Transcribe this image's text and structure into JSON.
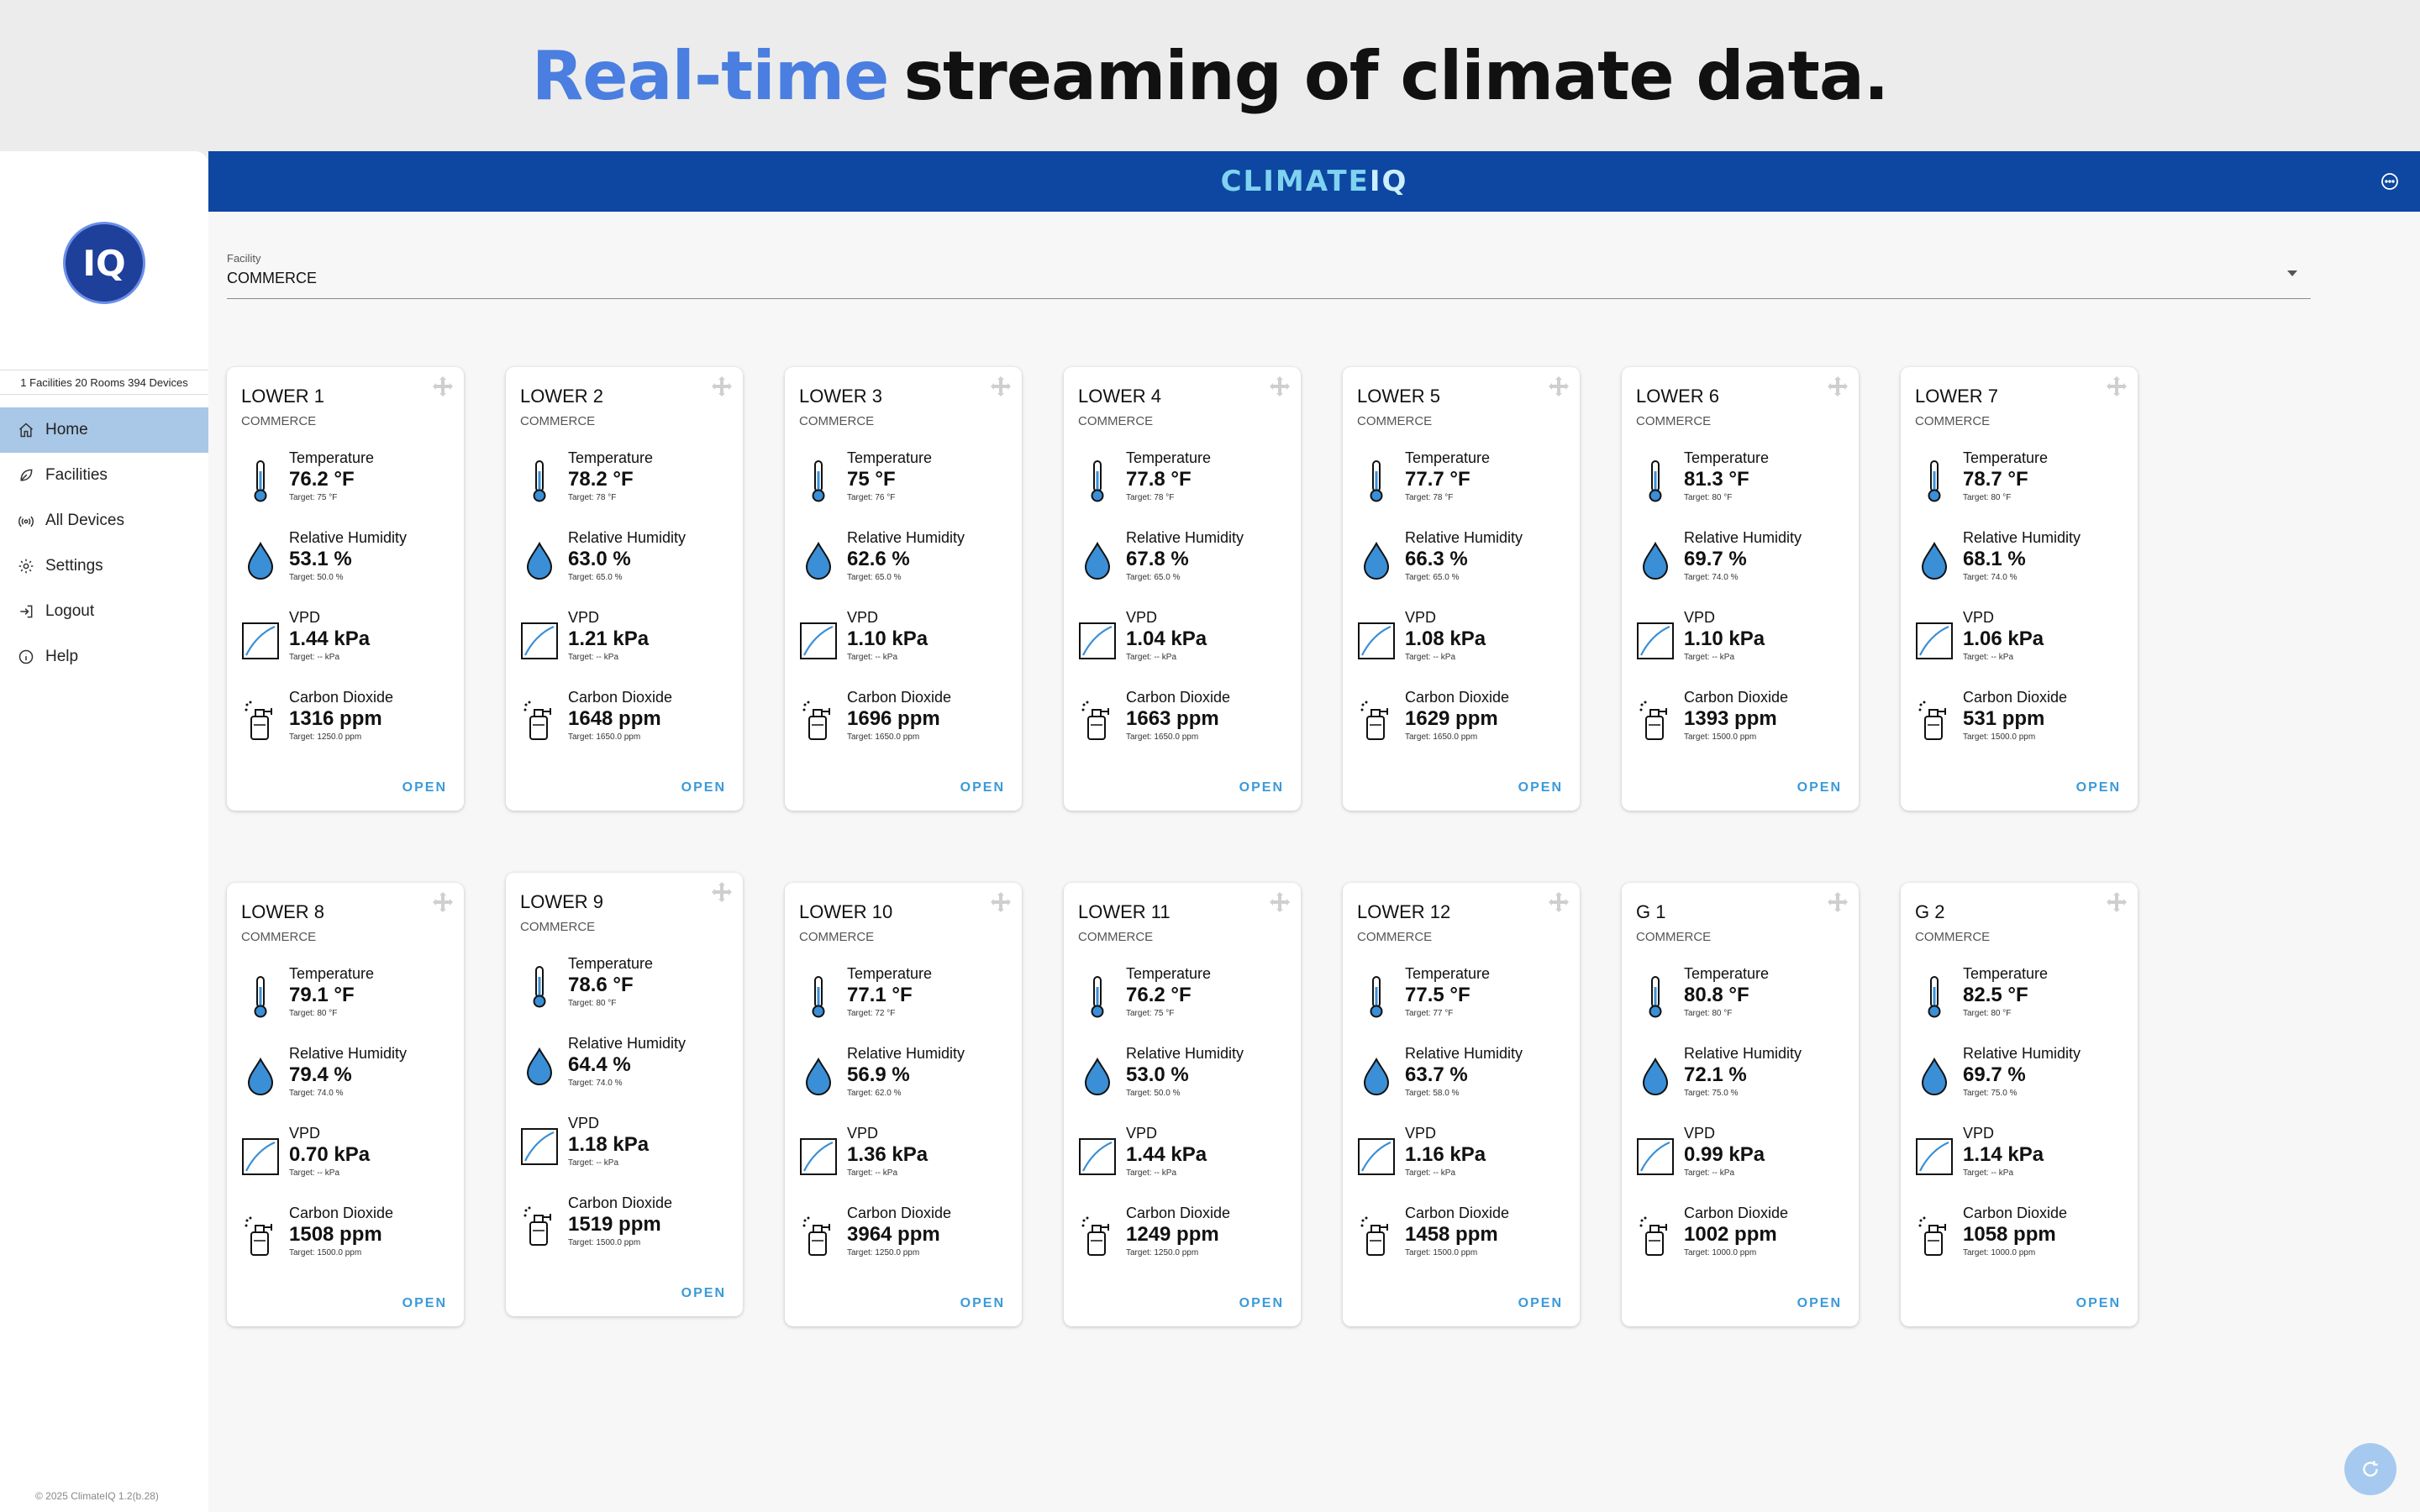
{
  "hero": {
    "accent": "Real-time",
    "rest": "streaming of climate data."
  },
  "brand": {
    "name_main": "CLIMATE",
    "name_iq": "IQ"
  },
  "sidebar": {
    "logo_text": "IQ",
    "stats": "1 Facilities 20 Rooms 394 Devices",
    "nav": [
      {
        "label": "Home",
        "icon": "home-icon",
        "active": true
      },
      {
        "label": "Facilities",
        "icon": "leaf-icon",
        "active": false
      },
      {
        "label": "All Devices",
        "icon": "sensor-icon",
        "active": false
      },
      {
        "label": "Settings",
        "icon": "gear-icon",
        "active": false
      },
      {
        "label": "Logout",
        "icon": "logout-icon",
        "active": false
      },
      {
        "label": "Help",
        "icon": "info-icon",
        "active": false
      }
    ],
    "copyright": "© 2025 ClimateIQ 1.2(b.28)"
  },
  "facility": {
    "label": "Facility",
    "value": "COMMERCE"
  },
  "labels": {
    "temperature": "Temperature",
    "humidity": "Relative Humidity",
    "vpd": "VPD",
    "co2": "Carbon Dioxide",
    "open": "OPEN"
  },
  "colors": {
    "appbar": "#0d47a1",
    "accent": "#4a7ee0",
    "drop": "#3a8fd6",
    "active_nav": "#a9c7e6",
    "open": "#3a9ad9"
  },
  "rooms": [
    {
      "name": "LOWER 1",
      "facility": "COMMERCE",
      "temp": "76.2 °F",
      "temp_target": "Target: 75 °F",
      "rh": "53.1 %",
      "rh_target": "Target: 50.0 %",
      "vpd": "1.44 kPa",
      "vpd_target": "Target: -- kPa",
      "co2": "1316 ppm",
      "co2_target": "Target: 1250.0 ppm"
    },
    {
      "name": "LOWER 2",
      "facility": "COMMERCE",
      "temp": "78.2 °F",
      "temp_target": "Target: 78 °F",
      "rh": "63.0 %",
      "rh_target": "Target: 65.0 %",
      "vpd": "1.21 kPa",
      "vpd_target": "Target: -- kPa",
      "co2": "1648 ppm",
      "co2_target": "Target: 1650.0 ppm"
    },
    {
      "name": "LOWER 3",
      "facility": "COMMERCE",
      "temp": "75 °F",
      "temp_target": "Target: 76 °F",
      "rh": "62.6 %",
      "rh_target": "Target: 65.0 %",
      "vpd": "1.10 kPa",
      "vpd_target": "Target: -- kPa",
      "co2": "1696 ppm",
      "co2_target": "Target: 1650.0 ppm"
    },
    {
      "name": "LOWER 4",
      "facility": "COMMERCE",
      "temp": "77.8 °F",
      "temp_target": "Target: 78 °F",
      "rh": "67.8 %",
      "rh_target": "Target: 65.0 %",
      "vpd": "1.04 kPa",
      "vpd_target": "Target: -- kPa",
      "co2": "1663 ppm",
      "co2_target": "Target: 1650.0 ppm"
    },
    {
      "name": "LOWER 5",
      "facility": "COMMERCE",
      "temp": "77.7 °F",
      "temp_target": "Target: 78 °F",
      "rh": "66.3 %",
      "rh_target": "Target: 65.0 %",
      "vpd": "1.08 kPa",
      "vpd_target": "Target: -- kPa",
      "co2": "1629 ppm",
      "co2_target": "Target: 1650.0 ppm"
    },
    {
      "name": "LOWER 6",
      "facility": "COMMERCE",
      "temp": "81.3 °F",
      "temp_target": "Target: 80 °F",
      "rh": "69.7 %",
      "rh_target": "Target: 74.0 %",
      "vpd": "1.10 kPa",
      "vpd_target": "Target: -- kPa",
      "co2": "1393 ppm",
      "co2_target": "Target: 1500.0 ppm"
    },
    {
      "name": "LOWER 7",
      "facility": "COMMERCE",
      "temp": "78.7 °F",
      "temp_target": "Target: 80 °F",
      "rh": "68.1 %",
      "rh_target": "Target: 74.0 %",
      "vpd": "1.06 kPa",
      "vpd_target": "Target: -- kPa",
      "co2": "531 ppm",
      "co2_target": "Target: 1500.0 ppm"
    },
    {
      "name": "LOWER 8",
      "facility": "COMMERCE",
      "temp": "79.1 °F",
      "temp_target": "Target: 80 °F",
      "rh": "79.4 %",
      "rh_target": "Target: 74.0 %",
      "vpd": "0.70 kPa",
      "vpd_target": "Target: -- kPa",
      "co2": "1508 ppm",
      "co2_target": "Target: 1500.0 ppm"
    },
    {
      "name": "LOWER 9",
      "facility": "COMMERCE",
      "temp": "78.6 °F",
      "temp_target": "Target: 80 °F",
      "rh": "64.4 %",
      "rh_target": "Target: 74.0 %",
      "vpd": "1.18 kPa",
      "vpd_target": "Target: -- kPa",
      "co2": "1519 ppm",
      "co2_target": "Target: 1500.0 ppm"
    },
    {
      "name": "LOWER 10",
      "facility": "COMMERCE",
      "temp": "77.1 °F",
      "temp_target": "Target: 72 °F",
      "rh": "56.9 %",
      "rh_target": "Target: 62.0 %",
      "vpd": "1.36 kPa",
      "vpd_target": "Target: -- kPa",
      "co2": "3964 ppm",
      "co2_target": "Target: 1250.0 ppm"
    },
    {
      "name": "LOWER 11",
      "facility": "COMMERCE",
      "temp": "76.2 °F",
      "temp_target": "Target: 75 °F",
      "rh": "53.0 %",
      "rh_target": "Target: 50.0 %",
      "vpd": "1.44 kPa",
      "vpd_target": "Target: -- kPa",
      "co2": "1249 ppm",
      "co2_target": "Target: 1250.0 ppm"
    },
    {
      "name": "LOWER 12",
      "facility": "COMMERCE",
      "temp": "77.5 °F",
      "temp_target": "Target: 77 °F",
      "rh": "63.7 %",
      "rh_target": "Target: 58.0 %",
      "vpd": "1.16 kPa",
      "vpd_target": "Target: -- kPa",
      "co2": "1458 ppm",
      "co2_target": "Target: 1500.0 ppm"
    },
    {
      "name": "G 1",
      "facility": "COMMERCE",
      "temp": "80.8 °F",
      "temp_target": "Target: 80 °F",
      "rh": "72.1 %",
      "rh_target": "Target: 75.0 %",
      "vpd": "0.99 kPa",
      "vpd_target": "Target: -- kPa",
      "co2": "1002 ppm",
      "co2_target": "Target: 1000.0 ppm"
    },
    {
      "name": "G 2",
      "facility": "COMMERCE",
      "temp": "82.5 °F",
      "temp_target": "Target: 80 °F",
      "rh": "69.7 %",
      "rh_target": "Target: 75.0 %",
      "vpd": "1.14 kPa",
      "vpd_target": "Target: -- kPa",
      "co2": "1058 ppm",
      "co2_target": "Target: 1000.0 ppm"
    }
  ]
}
